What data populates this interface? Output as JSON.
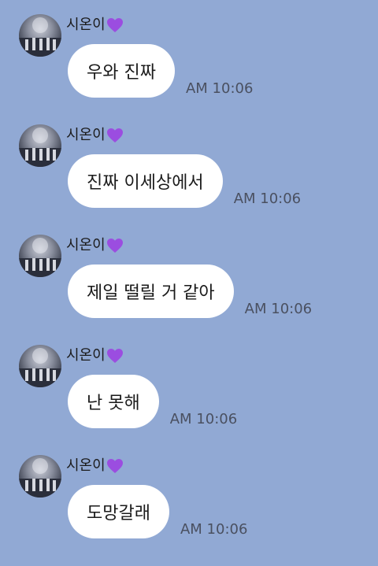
{
  "theme": {
    "background": "#91a9d4",
    "bubble": "#ffffff",
    "heart": "#9b4de0"
  },
  "messages": [
    {
      "sender": "시온이",
      "sender_badge": "purple-heart-icon",
      "text": "우와 진짜",
      "time": "AM 10:06"
    },
    {
      "sender": "시온이",
      "sender_badge": "purple-heart-icon",
      "text": "진짜 이세상에서",
      "time": "AM 10:06"
    },
    {
      "sender": "시온이",
      "sender_badge": "purple-heart-icon",
      "text": "제일 떨릴 거 같아",
      "time": "AM 10:06"
    },
    {
      "sender": "시온이",
      "sender_badge": "purple-heart-icon",
      "text": "난 못해",
      "time": "AM 10:06"
    },
    {
      "sender": "시온이",
      "sender_badge": "purple-heart-icon",
      "text": "도망갈래",
      "time": "AM 10:06"
    }
  ]
}
